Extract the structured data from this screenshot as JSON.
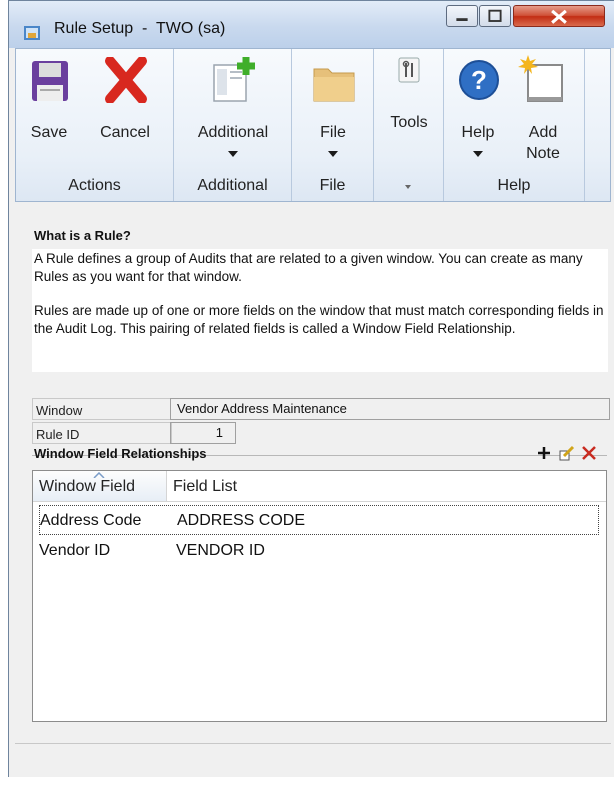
{
  "window": {
    "title": "Rule Setup  -  TWO (sa)"
  },
  "ribbon": {
    "save": "Save",
    "cancel": "Cancel",
    "additional": "Additional",
    "file": "File",
    "tools": "Tools",
    "help": "Help",
    "add_note": "Add\nNote",
    "groups": {
      "actions": "Actions",
      "additional": "Additional",
      "file": "File",
      "help": "Help"
    }
  },
  "info": {
    "title": "What is a Rule?",
    "p1": "A Rule defines a group of Audits that are related to a given window.  You can create as many Rules as you want for that window.",
    "p2": "Rules are made up of one or more fields on the window that must match corresponding fields in the Audit Log.  This pairing of related fields is called a Window Field Relationship."
  },
  "fields": {
    "window_label": "Window",
    "window_value": "Vendor Address Maintenance",
    "rule_id_label": "Rule ID",
    "rule_id_value": "1"
  },
  "relationships": {
    "title": "Window Field Relationships",
    "columns": [
      "Window Field",
      "Field List"
    ],
    "rows": [
      {
        "window_field": "Address Code",
        "field_list": "ADDRESS CODE"
      },
      {
        "window_field": "Vendor ID",
        "field_list": "VENDOR ID"
      }
    ]
  },
  "colors": {
    "save": "#6b3f9e",
    "cancel": "#d8281f",
    "help": "#2f6fc4",
    "add_green": "#3fae2a"
  }
}
